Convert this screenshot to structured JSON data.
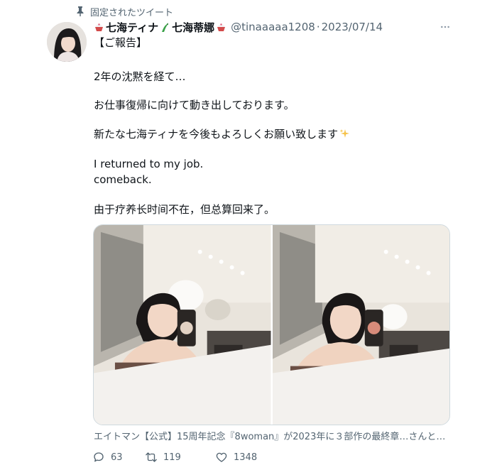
{
  "pinned": {
    "label": "固定されたツイート",
    "icon": "pin-icon"
  },
  "author": {
    "avatar_icon": "avatar",
    "name_prefix_emoji": "shaved-ice-emoji",
    "name_part1": "七海ティナ",
    "name_mid_emoji": "dragon-emoji",
    "name_part2": "七海蒂娜",
    "name_suffix_emoji": "shaved-ice-emoji",
    "handle": "@tinaaaaa1208",
    "separator": "·",
    "date": "2023/07/14"
  },
  "more_icon": "more-icon",
  "tweet": {
    "lines": [
      "【ご報告】",
      "2年の沈黙を経て…",
      "お仕事復帰に向けて動き出しております。",
      "新たな七海ティナを今後もよろしくお願い致します",
      "I returned to my job.",
      "comeback.",
      "由于疗养长时间不在，但总算回来了。"
    ]
  },
  "quote_line": "エイトマン【公式】15周年記念『8woman』が2023年に３部作の最終章…さんとエ…",
  "actions": {
    "replies": "63",
    "retweets": "119",
    "likes": "1348"
  },
  "colors": {
    "text": "#0f1419",
    "secondary": "#536471",
    "border": "#cfd9de"
  }
}
